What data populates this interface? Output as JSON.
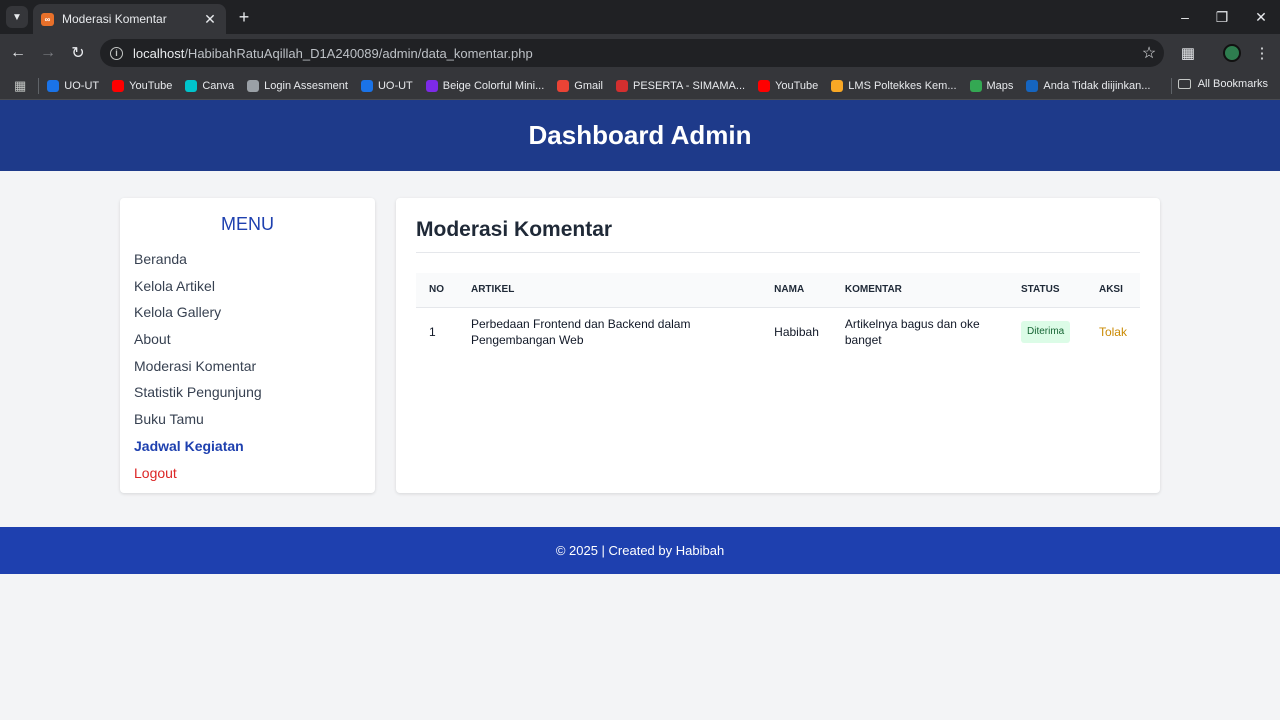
{
  "browser": {
    "tab_title": "Moderasi Komentar",
    "url_host": "localhost",
    "url_path": "/HabibahRatuAqillah_D1A240089/admin/data_komentar.php",
    "bookmarks": [
      {
        "label": "UO-UT",
        "icon": "ut-icon",
        "color": "#1a73e8"
      },
      {
        "label": "YouTube",
        "icon": "youtube-icon",
        "color": "#ff0000"
      },
      {
        "label": "Canva",
        "icon": "canva-icon",
        "color": "#00c4cc"
      },
      {
        "label": "Login Assesment",
        "icon": "globe-icon",
        "color": "#9aa0a6"
      },
      {
        "label": "UO-UT",
        "icon": "ut-icon",
        "color": "#1a73e8"
      },
      {
        "label": "Beige Colorful Mini...",
        "icon": "canva-icon",
        "color": "#7d2ae8"
      },
      {
        "label": "Gmail",
        "icon": "gmail-icon",
        "color": "#ea4335"
      },
      {
        "label": "PESERTA - SIMAMA...",
        "icon": "simama-icon",
        "color": "#d32f2f"
      },
      {
        "label": "YouTube",
        "icon": "youtube-icon",
        "color": "#ff0000"
      },
      {
        "label": "LMS Poltekkes Kem...",
        "icon": "lms-icon",
        "color": "#f9a825"
      },
      {
        "label": "Maps",
        "icon": "maps-icon",
        "color": "#34a853"
      },
      {
        "label": "Anda Tidak diijinkan...",
        "icon": "kemdikbud-icon",
        "color": "#1565c0"
      }
    ],
    "all_bookmarks": "All Bookmarks"
  },
  "header": {
    "title": "Dashboard Admin"
  },
  "sidebar": {
    "title": "MENU",
    "items": [
      {
        "label": "Beranda",
        "style": "normal"
      },
      {
        "label": "Kelola Artikel",
        "style": "normal"
      },
      {
        "label": "Kelola Gallery",
        "style": "normal"
      },
      {
        "label": "About",
        "style": "normal"
      },
      {
        "label": "Moderasi Komentar",
        "style": "normal"
      },
      {
        "label": "Statistik Pengunjung",
        "style": "normal"
      },
      {
        "label": "Buku Tamu",
        "style": "normal"
      },
      {
        "label": "Jadwal Kegiatan",
        "style": "active"
      },
      {
        "label": "Logout",
        "style": "logout"
      }
    ]
  },
  "main": {
    "title": "Moderasi Komentar",
    "columns": [
      "NO",
      "ARTIKEL",
      "NAMA",
      "KOMENTAR",
      "STATUS",
      "AKSI"
    ],
    "rows": [
      {
        "no": "1",
        "artikel": "Perbedaan Frontend dan Backend dalam Pengembangan Web",
        "nama": "Habibah",
        "komentar": "Artikelnya bagus dan oke banget",
        "status": "Diterima",
        "aksi": "Tolak"
      }
    ]
  },
  "footer": {
    "text": "© 2025 | Created by Habibah"
  },
  "colors": {
    "header": "#1e3a8a",
    "footer": "#1e40af",
    "accent": "#1e40af",
    "logout": "#dc2626",
    "badge_bg": "#dcfce7",
    "action": "#ca8a04"
  }
}
